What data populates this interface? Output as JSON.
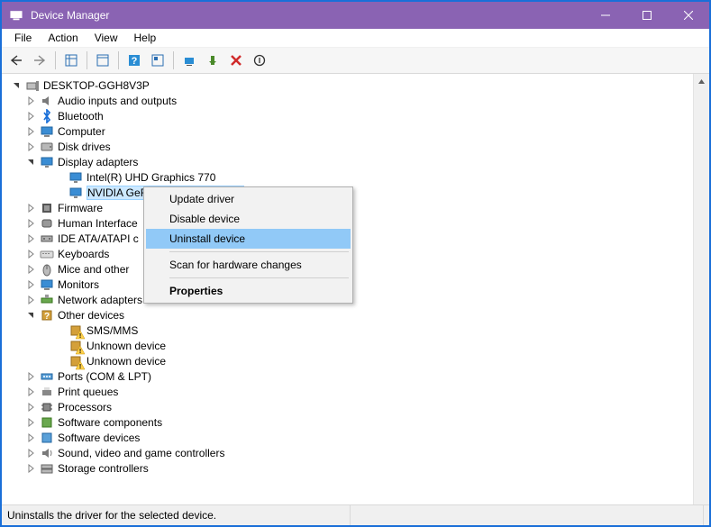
{
  "title": "Device Manager",
  "menubar": [
    "File",
    "Action",
    "View",
    "Help"
  ],
  "root": "DESKTOP-GGH8V3P",
  "tree": [
    {
      "label": "Audio inputs and outputs",
      "icon": "audio",
      "expanded": false
    },
    {
      "label": "Bluetooth",
      "icon": "bt",
      "expanded": false
    },
    {
      "label": "Computer",
      "icon": "computer",
      "expanded": false
    },
    {
      "label": "Disk drives",
      "icon": "disk",
      "expanded": false
    },
    {
      "label": "Display adapters",
      "icon": "display",
      "expanded": true,
      "children": [
        {
          "label": "Intel(R) UHD Graphics 770"
        },
        {
          "label": "NVIDIA GeFo",
          "selected": true
        }
      ]
    },
    {
      "label": "Firmware",
      "icon": "firmware",
      "expanded": false
    },
    {
      "label": "Human Interface",
      "icon": "hid",
      "expanded": false,
      "truncated": true
    },
    {
      "label": "IDE ATA/ATAPI c",
      "icon": "ide",
      "expanded": false,
      "truncated": true
    },
    {
      "label": "Keyboards",
      "icon": "keyboard",
      "expanded": false
    },
    {
      "label": "Mice and other",
      "icon": "mouse",
      "expanded": false,
      "truncated": true
    },
    {
      "label": "Monitors",
      "icon": "monitor",
      "expanded": false
    },
    {
      "label": "Network adapters",
      "icon": "network",
      "expanded": false
    },
    {
      "label": "Other devices",
      "icon": "other",
      "expanded": true,
      "children": [
        {
          "label": "SMS/MMS",
          "warn": true
        },
        {
          "label": "Unknown device",
          "warn": true
        },
        {
          "label": "Unknown device",
          "warn": true
        }
      ]
    },
    {
      "label": "Ports (COM & LPT)",
      "icon": "ports",
      "expanded": false
    },
    {
      "label": "Print queues",
      "icon": "print",
      "expanded": false
    },
    {
      "label": "Processors",
      "icon": "cpu",
      "expanded": false
    },
    {
      "label": "Software components",
      "icon": "swc",
      "expanded": false
    },
    {
      "label": "Software devices",
      "icon": "swd",
      "expanded": false
    },
    {
      "label": "Sound, video and game controllers",
      "icon": "sound",
      "expanded": false
    },
    {
      "label": "Storage controllers",
      "icon": "storage",
      "expanded": false,
      "cut": true
    }
  ],
  "context_menu": {
    "items": [
      {
        "label": "Update driver"
      },
      {
        "label": "Disable device"
      },
      {
        "label": "Uninstall device",
        "highlight": true
      },
      {
        "sep": true
      },
      {
        "label": "Scan for hardware changes"
      },
      {
        "sep": true
      },
      {
        "label": "Properties",
        "bold": true
      }
    ]
  },
  "statusbar": "Uninstalls the driver for the selected device."
}
